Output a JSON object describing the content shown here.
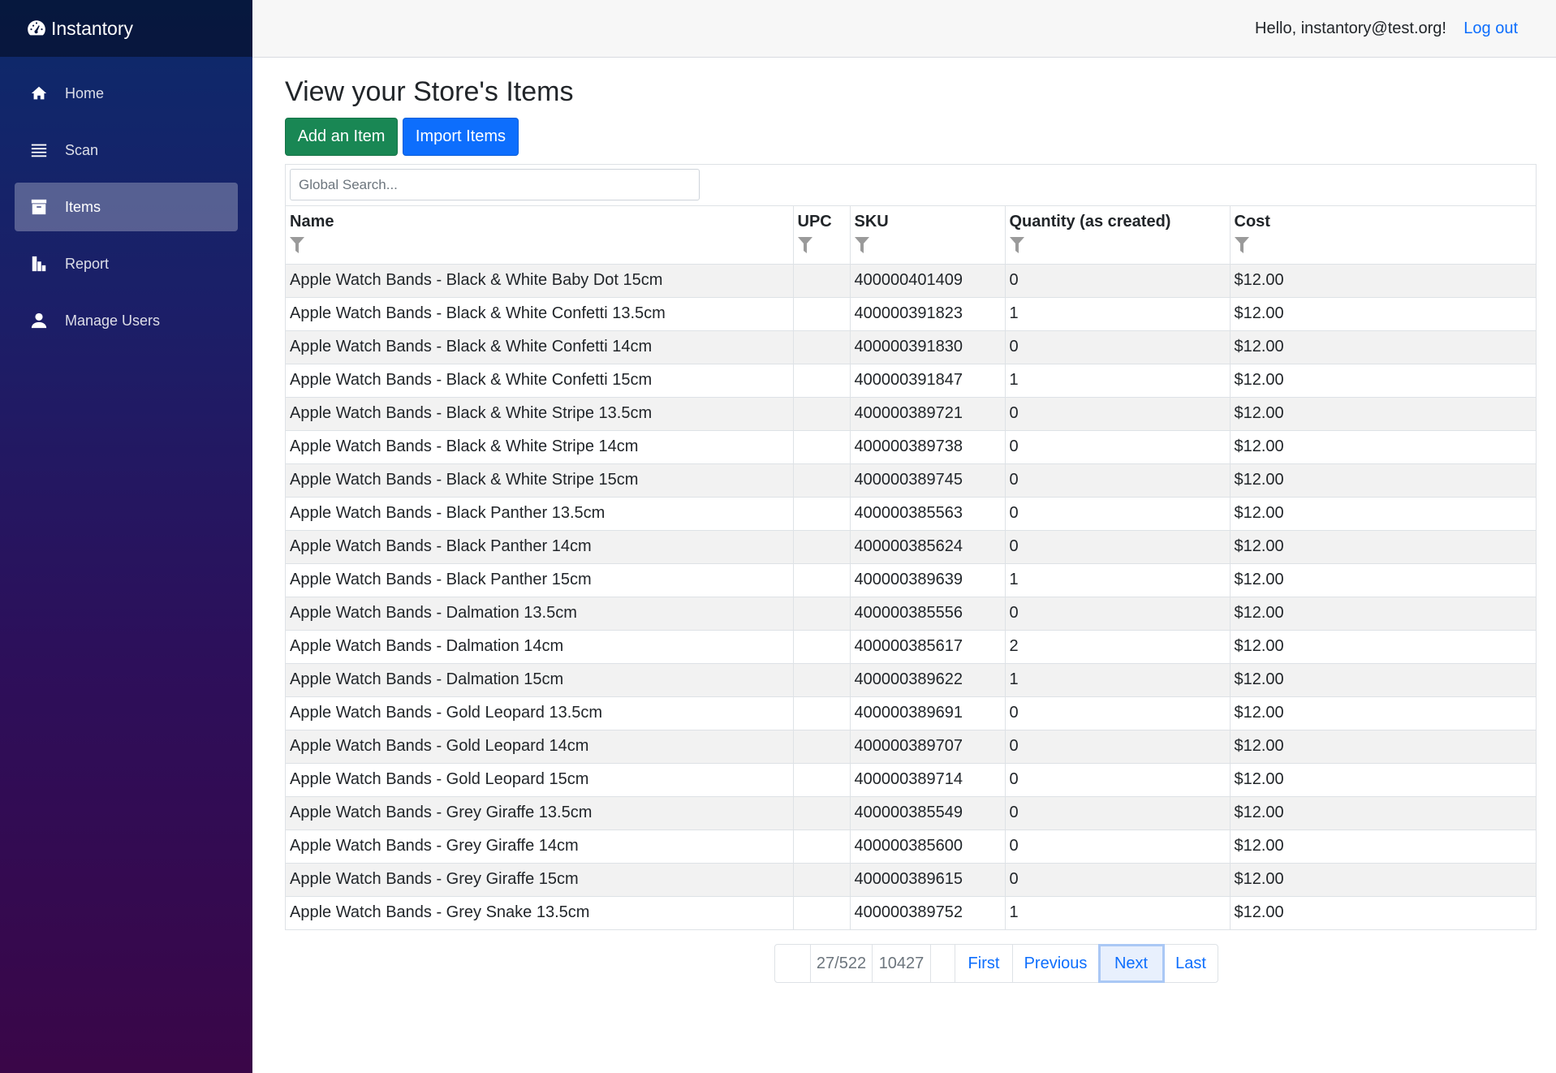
{
  "app": {
    "brand": "Instantory"
  },
  "sidebar": {
    "items": [
      {
        "label": "Home"
      },
      {
        "label": "Scan"
      },
      {
        "label": "Items"
      },
      {
        "label": "Report"
      },
      {
        "label": "Manage Users"
      }
    ]
  },
  "header": {
    "greeting": "Hello, instantory@test.org!",
    "logout": "Log out"
  },
  "page": {
    "title": "View your Store's Items",
    "add_button": "Add an Item",
    "import_button": "Import Items",
    "search_placeholder": "Global Search..."
  },
  "table": {
    "columns": [
      "Name",
      "UPC",
      "SKU",
      "Quantity (as created)",
      "Cost"
    ],
    "rows": [
      [
        "Apple Watch Bands - Black & White Baby Dot 15cm",
        "",
        "400000401409",
        "0",
        "$12.00"
      ],
      [
        "Apple Watch Bands - Black & White Confetti 13.5cm",
        "",
        "400000391823",
        "1",
        "$12.00"
      ],
      [
        "Apple Watch Bands - Black & White Confetti 14cm",
        "",
        "400000391830",
        "0",
        "$12.00"
      ],
      [
        "Apple Watch Bands - Black & White Confetti 15cm",
        "",
        "400000391847",
        "1",
        "$12.00"
      ],
      [
        "Apple Watch Bands - Black & White Stripe 13.5cm",
        "",
        "400000389721",
        "0",
        "$12.00"
      ],
      [
        "Apple Watch Bands - Black & White Stripe 14cm",
        "",
        "400000389738",
        "0",
        "$12.00"
      ],
      [
        "Apple Watch Bands - Black & White Stripe 15cm",
        "",
        "400000389745",
        "0",
        "$12.00"
      ],
      [
        "Apple Watch Bands - Black Panther 13.5cm",
        "",
        "400000385563",
        "0",
        "$12.00"
      ],
      [
        "Apple Watch Bands - Black Panther 14cm",
        "",
        "400000385624",
        "0",
        "$12.00"
      ],
      [
        "Apple Watch Bands - Black Panther 15cm",
        "",
        "400000389639",
        "1",
        "$12.00"
      ],
      [
        "Apple Watch Bands - Dalmation 13.5cm",
        "",
        "400000385556",
        "0",
        "$12.00"
      ],
      [
        "Apple Watch Bands - Dalmation 14cm",
        "",
        "400000385617",
        "2",
        "$12.00"
      ],
      [
        "Apple Watch Bands - Dalmation 15cm",
        "",
        "400000389622",
        "1",
        "$12.00"
      ],
      [
        "Apple Watch Bands - Gold Leopard 13.5cm",
        "",
        "400000389691",
        "0",
        "$12.00"
      ],
      [
        "Apple Watch Bands - Gold Leopard 14cm",
        "",
        "400000389707",
        "0",
        "$12.00"
      ],
      [
        "Apple Watch Bands - Gold Leopard 15cm",
        "",
        "400000389714",
        "0",
        "$12.00"
      ],
      [
        "Apple Watch Bands - Grey Giraffe 13.5cm",
        "",
        "400000385549",
        "0",
        "$12.00"
      ],
      [
        "Apple Watch Bands - Grey Giraffe 14cm",
        "",
        "400000385600",
        "0",
        "$12.00"
      ],
      [
        "Apple Watch Bands - Grey Giraffe 15cm",
        "",
        "400000389615",
        "0",
        "$12.00"
      ],
      [
        "Apple Watch Bands - Grey Snake 13.5cm",
        "",
        "400000389752",
        "1",
        "$12.00"
      ]
    ]
  },
  "pager": {
    "page_info": "27/522",
    "total": "10427",
    "first": "First",
    "previous": "Previous",
    "next": "Next",
    "last": "Last"
  }
}
